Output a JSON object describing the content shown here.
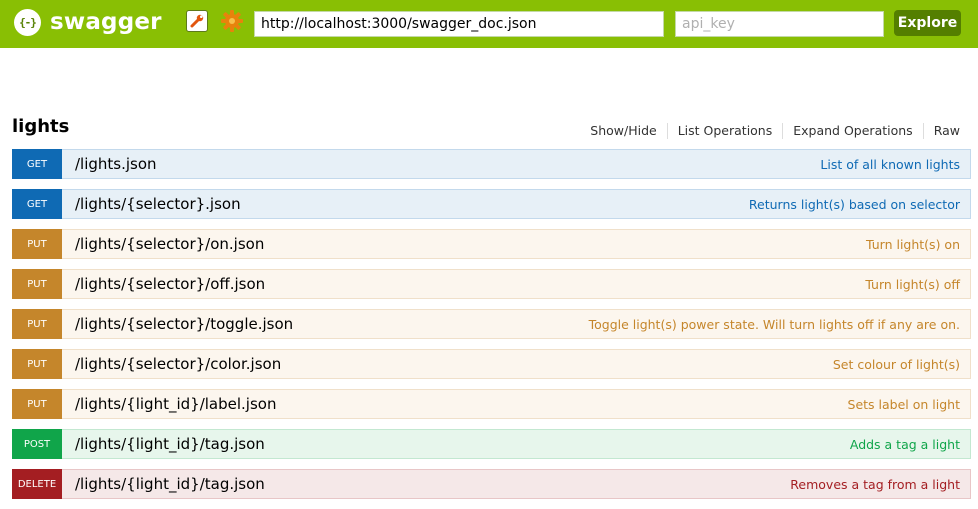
{
  "header": {
    "brand": "swagger",
    "logo_glyph": "{-}",
    "url_value": "http://localhost:3000/swagger_doc.json",
    "api_key_placeholder": "api_key",
    "explore_label": "Explore",
    "colors": {
      "bar": "#89bf04",
      "explore_button": "#547f00",
      "gear": "#e8830c"
    }
  },
  "resource": {
    "name": "lights",
    "links": [
      "Show/Hide",
      "List Operations",
      "Expand Operations",
      "Raw"
    ]
  },
  "operations": [
    {
      "method": "GET",
      "path": "/lights.json",
      "summary": "List of all known lights"
    },
    {
      "method": "GET",
      "path": "/lights/{selector}.json",
      "summary": "Returns light(s) based on selector"
    },
    {
      "method": "PUT",
      "path": "/lights/{selector}/on.json",
      "summary": "Turn light(s) on"
    },
    {
      "method": "PUT",
      "path": "/lights/{selector}/off.json",
      "summary": "Turn light(s) off"
    },
    {
      "method": "PUT",
      "path": "/lights/{selector}/toggle.json",
      "summary": "Toggle light(s) power state. Will turn lights off if any are on."
    },
    {
      "method": "PUT",
      "path": "/lights/{selector}/color.json",
      "summary": "Set colour of light(s)"
    },
    {
      "method": "PUT",
      "path": "/lights/{light_id}/label.json",
      "summary": "Sets label on light"
    },
    {
      "method": "POST",
      "path": "/lights/{light_id}/tag.json",
      "summary": "Adds a tag a light"
    },
    {
      "method": "DELETE",
      "path": "/lights/{light_id}/tag.json",
      "summary": "Removes a tag from a light"
    }
  ],
  "method_colors": {
    "GET": "#0f6ab4",
    "PUT": "#c5862b",
    "POST": "#10a54a",
    "DELETE": "#a41e22"
  }
}
